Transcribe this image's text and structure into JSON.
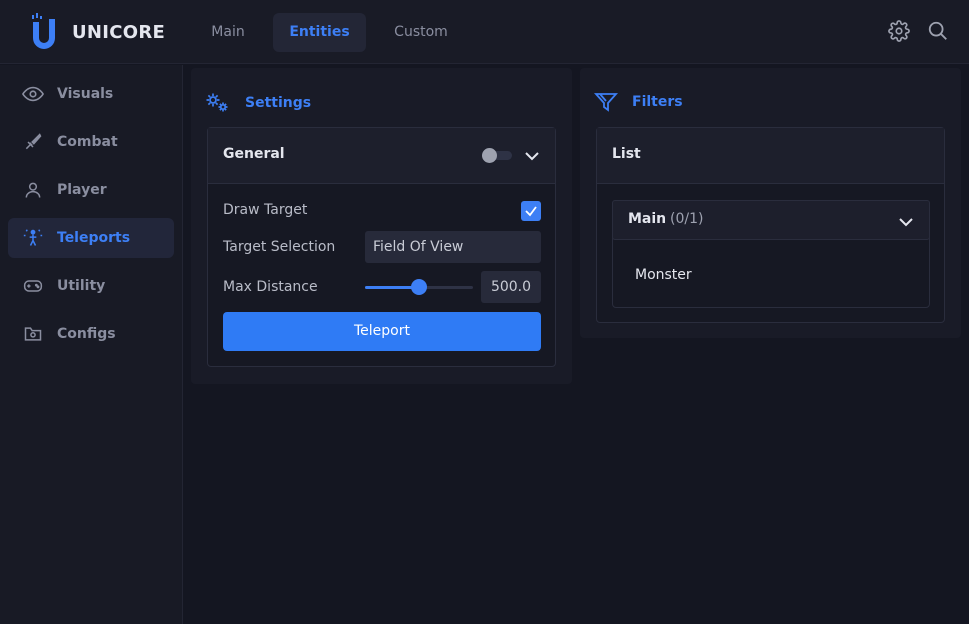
{
  "app": {
    "name": "UNICORE"
  },
  "tabs": [
    {
      "label": "Main",
      "active": false
    },
    {
      "label": "Entities",
      "active": true
    },
    {
      "label": "Custom",
      "active": false
    }
  ],
  "top_icons": [
    "gear-icon",
    "search-icon"
  ],
  "sidebar": {
    "items": [
      {
        "label": "Visuals",
        "icon": "eye-icon",
        "active": false
      },
      {
        "label": "Combat",
        "icon": "sword-icon",
        "active": false
      },
      {
        "label": "Player",
        "icon": "user-icon",
        "active": false
      },
      {
        "label": "Teleports",
        "icon": "teleport-icon",
        "active": true
      },
      {
        "label": "Utility",
        "icon": "gamepad-icon",
        "active": false
      },
      {
        "label": "Configs",
        "icon": "folder-gear-icon",
        "active": false
      }
    ]
  },
  "settings": {
    "title": "Settings",
    "general": {
      "title": "General",
      "enabled": false,
      "draw_target": {
        "label": "Draw Target",
        "checked": true
      },
      "target_selection": {
        "label": "Target Selection",
        "value": "Field Of View"
      },
      "max_distance": {
        "label": "Max Distance",
        "value": "500.0",
        "fraction": 0.5
      },
      "teleport_button": "Teleport"
    }
  },
  "filters": {
    "title": "Filters",
    "list": {
      "title": "List",
      "group": {
        "name": "Main",
        "count": "(0/1)",
        "expanded": true
      },
      "items": [
        "Monster"
      ]
    }
  },
  "colors": {
    "accent": "#3d7ff5",
    "background": "#141621",
    "panel": "#191b27",
    "text": "#c9ccd6"
  }
}
